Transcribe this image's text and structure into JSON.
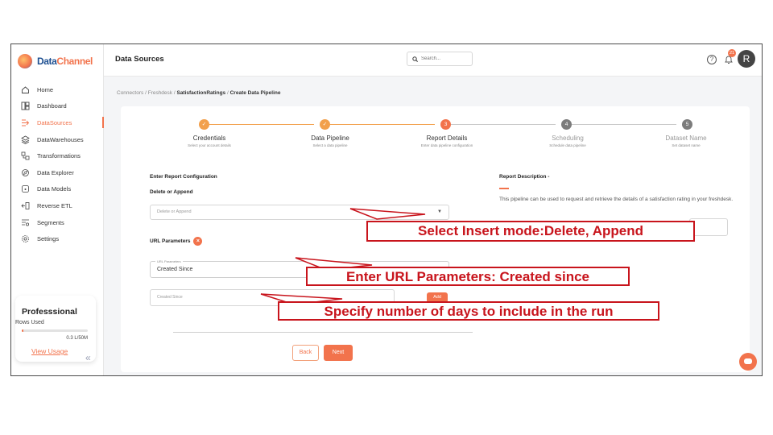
{
  "app": {
    "logo_text_a": "Data",
    "logo_text_b": "Channel",
    "brand_color": "#f2734c",
    "brand_dark": "#1d4f91"
  },
  "sidebar": {
    "items": [
      {
        "label": "Home",
        "icon": "home-icon"
      },
      {
        "label": "Dashboard",
        "icon": "dashboard-icon"
      },
      {
        "label": "DataSources",
        "icon": "datasources-icon",
        "active": true
      },
      {
        "label": "DataWarehouses",
        "icon": "warehouse-icon"
      },
      {
        "label": "Transformations",
        "icon": "transform-icon"
      },
      {
        "label": "Data Explorer",
        "icon": "explorer-icon"
      },
      {
        "label": "Data Models",
        "icon": "models-icon"
      },
      {
        "label": "Reverse ETL",
        "icon": "reverse-etl-icon"
      },
      {
        "label": "Segments",
        "icon": "segments-icon"
      },
      {
        "label": "Settings",
        "icon": "gear-icon"
      }
    ],
    "plan": {
      "name": "Professsional",
      "rows_label": "Rows Used",
      "usage": "0.3 L/50M",
      "usage_fraction": 0.006,
      "link": "View Usage"
    },
    "collapse_glyph": "«"
  },
  "header": {
    "title": "Data Sources",
    "search_placeholder": "Search...",
    "help_glyph": "?",
    "notification_count": "21",
    "avatar_initial": "R"
  },
  "breadcrumb": {
    "part1": "Connectors",
    "sep": "/",
    "part2": "Freshdesk",
    "part3": "SatisfactionRatings",
    "part4": "Create Data Pipeline"
  },
  "stepper": {
    "steps": [
      {
        "title": "Credentials",
        "subtitle": "Select your account details",
        "status": "done",
        "marker": "✓"
      },
      {
        "title": "Data Pipeline",
        "subtitle": "Select a data pipeline",
        "status": "done",
        "marker": "✓"
      },
      {
        "title": "Report Details",
        "subtitle": "Enter data pipeline configuration",
        "status": "current",
        "marker": "3"
      },
      {
        "title": "Scheduling",
        "subtitle": "Schedule data pipeline",
        "status": "todo",
        "marker": "4"
      },
      {
        "title": "Dataset Name",
        "subtitle": "Set dataset name",
        "status": "todo",
        "marker": "5"
      }
    ]
  },
  "form": {
    "config_heading": "Enter Report Configuration",
    "delete_append_label": "Delete or Append",
    "delete_append_placeholder": "Delete or Append",
    "url_params_label": "URL Parameters",
    "url_params_legend": "URL Parameters",
    "url_params_value": "Created Since",
    "created_since_placeholder": "Created Since",
    "add_label": "Add",
    "back_label": "Back",
    "next_label": "Next"
  },
  "report_description": {
    "label": "Report Description -",
    "text": "This pipeline can be used to request and retrieve the details of a satisfaction rating in your freshdesk."
  },
  "callouts": {
    "insert_mode": "Select Insert mode:Delete, Append",
    "url_params": "Enter URL Parameters: Created since",
    "days": "Specify number of days to include in the run"
  }
}
